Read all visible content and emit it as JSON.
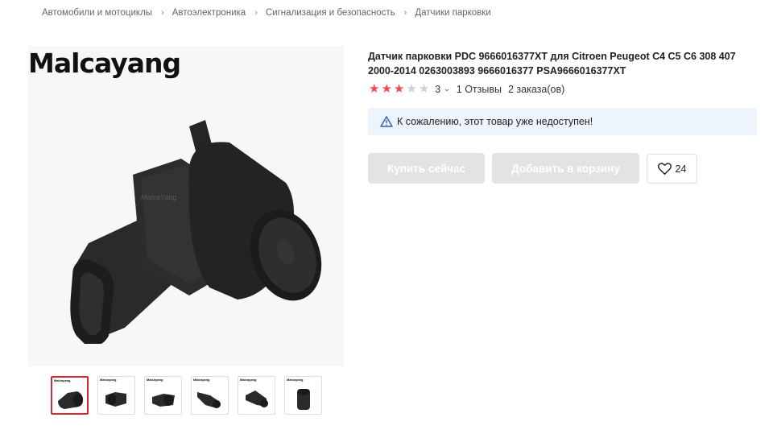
{
  "breadcrumb": [
    "Автомобили и мотоциклы",
    "Автоэлектроника",
    "Сигнализация и безопасность",
    "Датчики парковки"
  ],
  "brand": {
    "logo_text": "Malcayang",
    "watermark": "MalcaYang"
  },
  "product": {
    "title": "Датчик парковки PDC 9666016377XT для Citroen Peugeot C4 C5 C6 308 407 2000-2014 0263003893 9666016377 PSA9666016377XT",
    "rating": 3,
    "rating_max": 5,
    "rating_label": "3",
    "reviews": "1 Отзывы",
    "orders": "2 заказа(ов)"
  },
  "notice": {
    "text": "К сожалению, этот товар уже недоступен!",
    "icon": "warning-triangle-icon"
  },
  "actions": {
    "buy_label": "Купить сейчас",
    "cart_label": "Добавить в корзину",
    "wishlist_count": "24"
  },
  "thumbnails": {
    "count": 6,
    "active_index": 0
  },
  "colors": {
    "star_on": "#f04a4f",
    "star_off": "#cfcfcf",
    "notice_bg": "#eef4fb",
    "disabled_btn": "#e3e3e3",
    "active_thumb_border": "#d8262f"
  }
}
